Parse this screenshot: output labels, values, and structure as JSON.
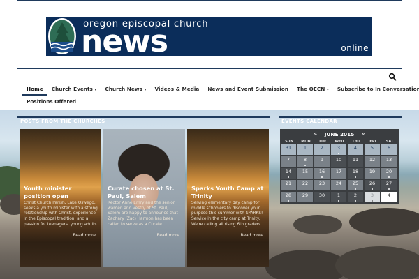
{
  "masthead": {
    "sub_title": "oregon episcopal church",
    "main_title": "news",
    "tagline": "online",
    "colors": {
      "background": "#0b2d5a",
      "text": "#ffffff"
    }
  },
  "nav": {
    "items": [
      {
        "label": "Home",
        "active": true
      },
      {
        "label": "Church Events",
        "caret": "▾"
      },
      {
        "label": "Church News",
        "caret": "▾"
      },
      {
        "label": "Videos & Media"
      },
      {
        "label": "News and Event Submission"
      },
      {
        "label": "The OECN",
        "caret": "▾"
      },
      {
        "label": "Subscribe to In Conversation"
      },
      {
        "label": "Positions Offered"
      }
    ]
  },
  "search": {
    "icon": "search-icon"
  },
  "posts": {
    "section_title": "POSTS FROM THE CHURCHES",
    "cards": [
      {
        "title": "Youth minister position open",
        "excerpt": "Christ Church Parish, Lake Oswego, seeks a youth minister with a strong relationship with Christ, experience in the Episcopal tradition, and a passion for teenagers, young adults",
        "more": "Read more"
      },
      {
        "title": "Curate chosen at St. Paul, Salem",
        "excerpt": "Rector Anne Emry and the senior warden and vestry of St. Paul, Salem are happy to announce that Zachary (Zac) Harmon has been called to serve as a Curate",
        "more": "Read more"
      },
      {
        "title": "Sparks Youth Camp at Trinity",
        "excerpt": "Serving elementary day camp for middle schoolers to discover your purpose this summer with SPARKS! Service in the city camp at Trinity. We're calling all rising 6th graders",
        "more": "Read more"
      }
    ]
  },
  "calendar": {
    "section_title": "EVENTS CALENDAR",
    "month_label": "JUNE 2015",
    "prev": "«",
    "next": "»",
    "weekdays": [
      "SUN",
      "MON",
      "TUE",
      "WED",
      "THU",
      "FRI",
      "SAT"
    ],
    "rows": [
      [
        {
          "d": "31",
          "t": "past"
        },
        {
          "d": "1",
          "t": "past"
        },
        {
          "d": "2",
          "t": "past"
        },
        {
          "d": "3",
          "t": "past",
          "e": true
        },
        {
          "d": "4",
          "t": "past"
        },
        {
          "d": "5",
          "t": "past"
        },
        {
          "d": "6",
          "t": "past"
        }
      ],
      [
        {
          "d": "7",
          "t": "mid"
        },
        {
          "d": "8",
          "t": "mid",
          "e": true
        },
        {
          "d": "9",
          "t": "mid"
        },
        {
          "d": "10",
          "t": "dark"
        },
        {
          "d": "11",
          "t": "dark"
        },
        {
          "d": "12",
          "t": "mid"
        },
        {
          "d": "13",
          "t": "mid"
        }
      ],
      [
        {
          "d": "14",
          "t": "dark",
          "e": true
        },
        {
          "d": "15",
          "t": "mid"
        },
        {
          "d": "16",
          "t": "mid",
          "e": true
        },
        {
          "d": "17",
          "t": "mid"
        },
        {
          "d": "18",
          "t": "dark",
          "e": true
        },
        {
          "d": "19",
          "t": "mid"
        },
        {
          "d": "20",
          "t": "mid",
          "e": true
        }
      ],
      [
        {
          "d": "21",
          "t": "mid"
        },
        {
          "d": "22",
          "t": "mid"
        },
        {
          "d": "23",
          "t": "mid"
        },
        {
          "d": "24",
          "t": "mid"
        },
        {
          "d": "25",
          "t": "mid",
          "e": true
        },
        {
          "d": "26",
          "t": "dark",
          "e": true
        },
        {
          "d": "27",
          "t": "dark",
          "e": true
        }
      ],
      [
        {
          "d": "28",
          "t": "mid",
          "e": true
        },
        {
          "d": "29",
          "t": "mid"
        },
        {
          "d": "30",
          "t": "dark"
        },
        {
          "d": "1",
          "t": "dark",
          "e": true
        },
        {
          "d": "2",
          "t": "dark",
          "e": true
        },
        {
          "d": "3",
          "t": "other",
          "e": true
        },
        {
          "d": "4",
          "t": "today"
        }
      ]
    ]
  }
}
